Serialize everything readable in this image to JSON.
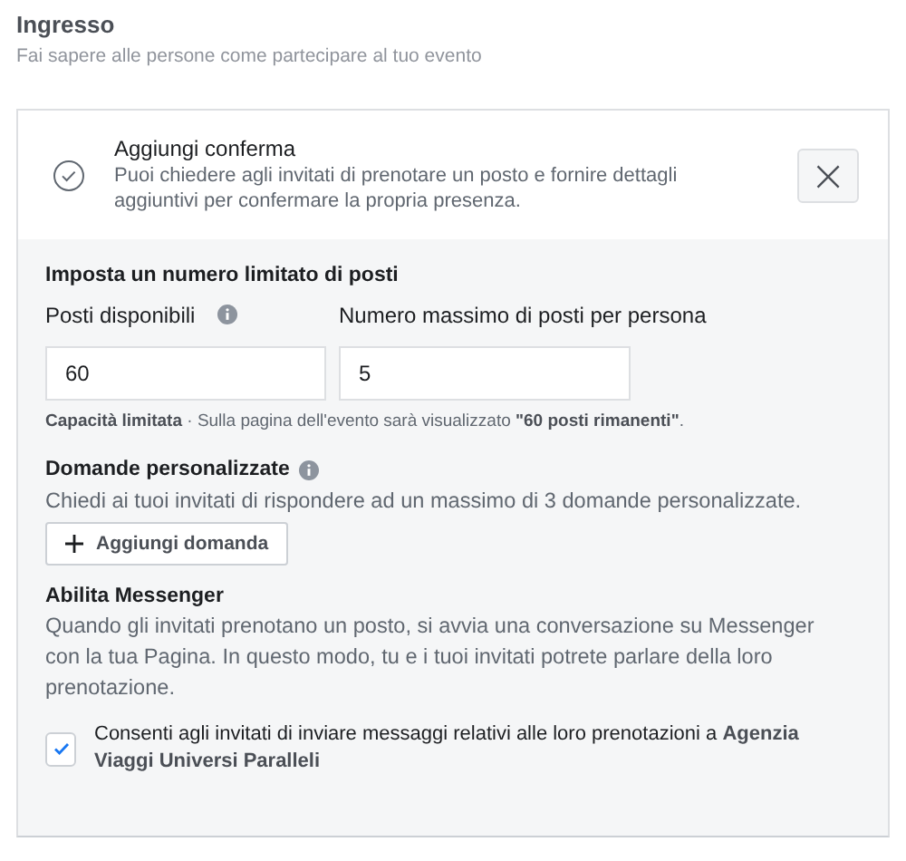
{
  "section": {
    "title": "Ingresso",
    "subtitle": "Fai sapere alle persone come partecipare al tuo evento"
  },
  "rsvp": {
    "title": "Aggiungi conferma",
    "description": "Puoi chiedere agli invitati di prenotare un posto e fornire dettagli aggiuntivi per confermare la propria presenza.",
    "close": "×"
  },
  "limit": {
    "title": "Imposta un numero limitato di posti",
    "fields": [
      {
        "label": "Posti disponibili",
        "info": true,
        "value": "60"
      },
      {
        "label": "Numero massimo di posti per persona",
        "value": "5"
      }
    ],
    "note": "**Capacità limitata** · Sulla pagina dell'evento sarà visualizzato **\"60 posti rimanenti\"**."
  },
  "questions": {
    "title": "Domande personalizzate",
    "description": "Chiedi ai tuoi invitati di rispondere ad un massimo di 3 domande personalizzate.",
    "button": "Aggiungi domanda"
  },
  "messenger": {
    "title": "Abilita Messenger",
    "description": "Quando gli invitati prenotano un posto, si avvia una conversazione su Messenger con la tua Pagina. In questo modo, tu e i tuoi invitati potrete parlare della loro prenotazione.",
    "consent": {
      "label": "Consenti agli invitati di inviare messaggi relativi alle loro prenotazioni a **Agenzia Viaggi Universi Paralleli**",
      "checked": true
    }
  }
}
